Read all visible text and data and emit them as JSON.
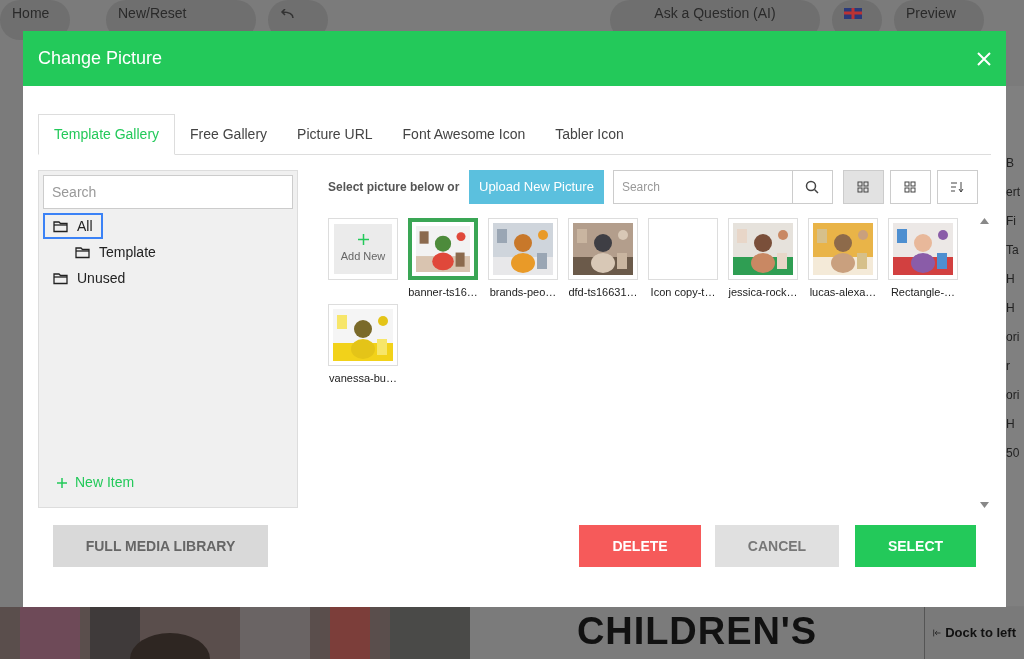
{
  "app_toolbar": [
    {
      "kind": "dropdown",
      "label": "Home"
    },
    {
      "kind": "dropdown",
      "label": "New/Reset"
    },
    {
      "kind": "undo"
    },
    {
      "kind": "ai",
      "label": "Ask a Question (AI)"
    },
    {
      "kind": "flag"
    },
    {
      "kind": "preview",
      "label": "Preview"
    }
  ],
  "side_panel_fragments": [
    "B",
    "ert",
    "Fi",
    "Ta",
    "H",
    "H",
    "ori",
    "r",
    "ori",
    "H",
    "50"
  ],
  "canvas_heading": "CHILDREN'S",
  "dock_button": "Dock to left",
  "dialog": {
    "title": "Change Picture",
    "tabs": [
      {
        "label": "Template Gallery",
        "selected": true
      },
      {
        "label": "Free Gallery",
        "selected": false
      },
      {
        "label": "Picture URL",
        "selected": false
      },
      {
        "label": "Font Awesome Icon",
        "selected": false
      },
      {
        "label": "Tabler Icon",
        "selected": false
      }
    ],
    "folder_search": {
      "placeholder": "Search"
    },
    "folders": [
      {
        "label": "All",
        "selected": true,
        "children": [
          {
            "label": "Template",
            "selected": false
          }
        ]
      },
      {
        "label": "Unused",
        "selected": false
      }
    ],
    "new_item": "New Item",
    "select_hint": "Select picture below or",
    "upload_button": "Upload New Picture",
    "picture_search": {
      "placeholder": "Search"
    },
    "view_buttons": [
      {
        "kind": "grid_large",
        "selected": true
      },
      {
        "kind": "grid_small",
        "selected": false
      },
      {
        "kind": "sort",
        "selected": false
      }
    ],
    "pictures": [
      {
        "kind": "add_new",
        "label": "Add New"
      },
      {
        "kind": "picture",
        "name": "banner-ts16…",
        "selected": true
      },
      {
        "kind": "picture",
        "name": "brands-peo…",
        "selected": false
      },
      {
        "kind": "picture",
        "name": "dfd-ts16631…",
        "selected": false
      },
      {
        "kind": "blank",
        "name": "Icon copy-t…",
        "selected": false
      },
      {
        "kind": "picture",
        "name": "jessica-rock…",
        "selected": false
      },
      {
        "kind": "picture",
        "name": "lucas-alexa…",
        "selected": false
      },
      {
        "kind": "picture",
        "name": "Rectangle-…",
        "selected": false
      },
      {
        "kind": "picture",
        "name": "vanessa-bu…",
        "selected": false
      }
    ],
    "footer_buttons": [
      {
        "kind": "secondary",
        "label": "FULL MEDIA LIBRARY"
      },
      {
        "kind": "danger",
        "label": "DELETE"
      },
      {
        "kind": "neutral",
        "label": "CANCEL"
      },
      {
        "kind": "primary",
        "label": "SELECT"
      }
    ]
  }
}
